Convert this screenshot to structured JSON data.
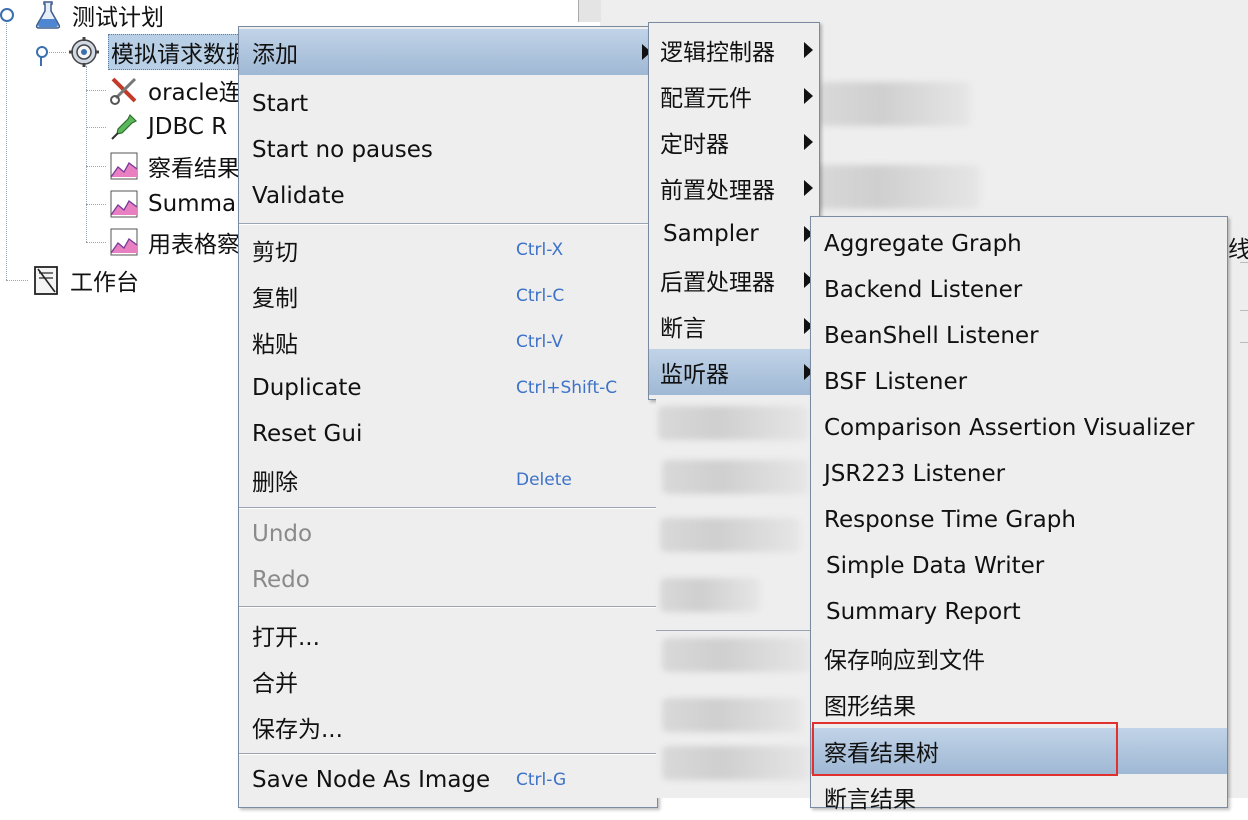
{
  "tree": {
    "nodes": [
      {
        "label": "测试计划",
        "icon": "flask-icon"
      },
      {
        "label": "模拟请求数据",
        "icon": "gear-icon"
      },
      {
        "label": "oracle连",
        "icon": "wrench-screwdriver-icon"
      },
      {
        "label": "JDBC R",
        "icon": "pipette-icon"
      },
      {
        "label": "察看结果",
        "icon": "graph-icon"
      },
      {
        "label": "Summa",
        "icon": "graph-icon"
      },
      {
        "label": "用表格察",
        "icon": "graph-icon"
      },
      {
        "label": "工作台",
        "icon": "notepad-icon"
      }
    ]
  },
  "context_menu": {
    "items": [
      {
        "label": "添加",
        "has_submenu": true
      },
      {
        "label": "Start"
      },
      {
        "label": "Start no pauses"
      },
      {
        "label": "Validate"
      },
      {
        "label": "剪切",
        "shortcut": "Ctrl-X"
      },
      {
        "label": "复制",
        "shortcut": "Ctrl-C"
      },
      {
        "label": "粘贴",
        "shortcut": "Ctrl-V"
      },
      {
        "label": "Duplicate",
        "shortcut": "Ctrl+Shift-C"
      },
      {
        "label": "Reset Gui"
      },
      {
        "label": "删除",
        "shortcut": "Delete"
      },
      {
        "label": "Undo",
        "disabled": true
      },
      {
        "label": "Redo",
        "disabled": true
      },
      {
        "label": "打开..."
      },
      {
        "label": "合并"
      },
      {
        "label": "保存为..."
      },
      {
        "label": "Save Node As Image",
        "shortcut": "Ctrl-G"
      }
    ]
  },
  "add_submenu": {
    "items": [
      {
        "label": "逻辑控制器"
      },
      {
        "label": "配置元件"
      },
      {
        "label": "定时器"
      },
      {
        "label": "前置处理器"
      },
      {
        "label": "Sampler"
      },
      {
        "label": "后置处理器"
      },
      {
        "label": "断言"
      },
      {
        "label": "监听器"
      }
    ]
  },
  "listener_submenu": {
    "items": [
      {
        "label": "Aggregate Graph"
      },
      {
        "label": "Backend Listener"
      },
      {
        "label": "BeanShell Listener"
      },
      {
        "label": "BSF Listener"
      },
      {
        "label": "Comparison Assertion Visualizer"
      },
      {
        "label": "JSR223 Listener"
      },
      {
        "label": "Response Time Graph"
      },
      {
        "label": "Simple Data Writer"
      },
      {
        "label": "Summary Report"
      },
      {
        "label": "保存响应到文件"
      },
      {
        "label": "图形结果"
      },
      {
        "label": "察看结果树"
      },
      {
        "label": "断言结果"
      }
    ]
  },
  "right_panel": {
    "partial_char": "线"
  },
  "colors": {
    "highlight": "#a9c0db",
    "annotation": "#e0312e",
    "shortcut": "#3d72c9"
  }
}
